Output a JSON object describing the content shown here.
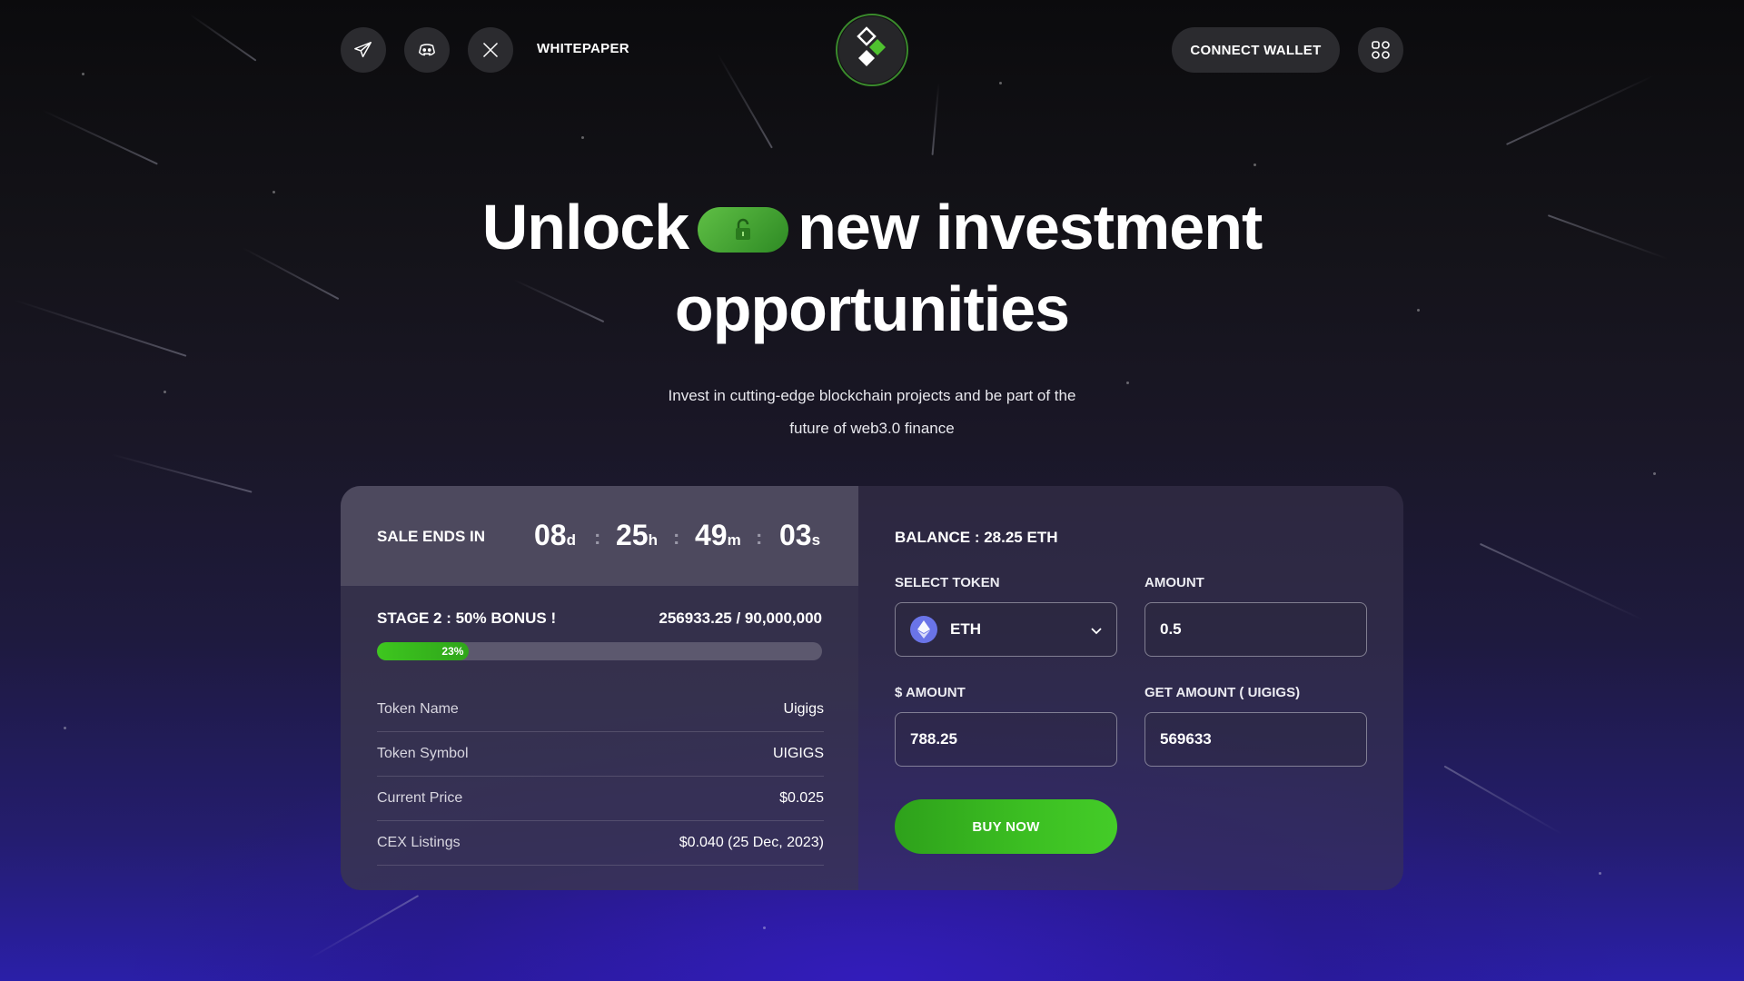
{
  "header": {
    "social": [
      {
        "name": "telegram-icon"
      },
      {
        "name": "discord-icon"
      },
      {
        "name": "x-icon"
      }
    ],
    "whitepaper_label": "WHITEPAPER",
    "connect_label": "CONNECT WALLET",
    "menu_icon": "grid-menu-icon"
  },
  "hero": {
    "title_part1": "Unlock",
    "title_part2": "new investment",
    "title_line2": "opportunities",
    "subtitle_line1": "Invest in cutting-edge blockchain projects and be part of the",
    "subtitle_line2": "future of web3.0 finance"
  },
  "sale": {
    "ends_label": "SALE ENDS IN",
    "timer": {
      "days": "08",
      "days_unit": "d",
      "hours": "25",
      "hours_unit": "h",
      "minutes": "49",
      "minutes_unit": "m",
      "seconds": "03",
      "seconds_unit": "s"
    },
    "separator": ":",
    "stage": "STAGE 2 :  50% BONUS !",
    "raised": "256933.25 / 90,000,000",
    "progress_percent": 23,
    "progress_label": "23%",
    "info": [
      {
        "key": "Token Name",
        "value": "Uigigs"
      },
      {
        "key": "Token Symbol",
        "value": "UIGIGS"
      },
      {
        "key": "Current Price",
        "value": "$0.025"
      },
      {
        "key": "CEX Listings",
        "value": "$0.040 (25 Dec, 2023)"
      }
    ]
  },
  "purchase": {
    "balance": "BALANCE : 28.25 ETH",
    "select_token_label": "SELECT TOKEN",
    "selected_token": "ETH",
    "amount_label": "AMOUNT",
    "amount_value": "0.5",
    "usd_amount_label": "$ AMOUNT",
    "usd_amount_value": "788.25",
    "get_amount_label": "GET AMOUNT ( UIGIGS)",
    "get_amount_value": "569633",
    "buy_label": "BUY NOW"
  },
  "colors": {
    "accent_green": "#3cbf22",
    "background_purple": "#2a1fa8",
    "eth_blue": "#6a74e8"
  }
}
